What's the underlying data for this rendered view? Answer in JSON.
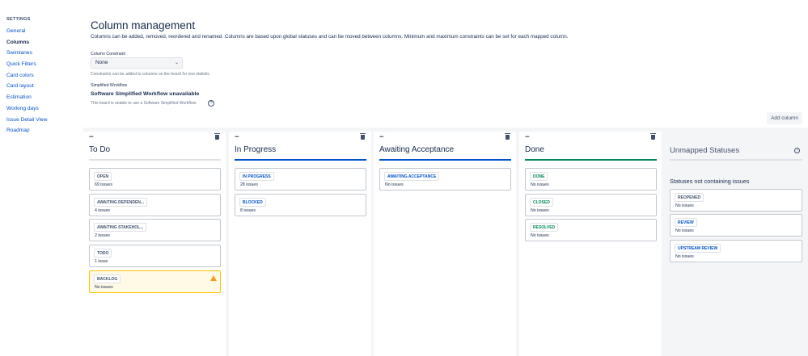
{
  "sidebar": {
    "heading": "SETTINGS",
    "items": [
      {
        "label": "General"
      },
      {
        "label": "Columns"
      },
      {
        "label": "Swimlanes"
      },
      {
        "label": "Quick Filters"
      },
      {
        "label": "Card colors"
      },
      {
        "label": "Card layout"
      },
      {
        "label": "Estimation"
      },
      {
        "label": "Working days"
      },
      {
        "label": "Issue Detail View"
      },
      {
        "label": "Roadmap"
      }
    ],
    "active": "Columns"
  },
  "header": {
    "title": "Column management",
    "description": "Columns can be added, removed, reordered and renamed. Columns are based upon global statuses and can be moved between columns. Minimum and maximum constraints can be set for each mapped column."
  },
  "constraint": {
    "label": "Column Constraint",
    "value": "None",
    "help": "Constraints can be added to columns on the board for one statistic."
  },
  "workflow": {
    "label": "Simplified Workflow",
    "title": "Software Simplified Workflow unavailable",
    "help": "This board is unable to use a Software Simplified Workflow."
  },
  "add_column_label": "Add column",
  "columns": [
    {
      "title": "To Do",
      "bar_color": "#dfe1e6",
      "cards": [
        {
          "status": "OPEN",
          "count": "69 issues",
          "tone": "grey"
        },
        {
          "status": "AWAITING DEPENDEN...",
          "count": "4 issues",
          "tone": "grey"
        },
        {
          "status": "AWAITING STAKEHOL...",
          "count": "2 issues",
          "tone": "grey"
        },
        {
          "status": "TODO",
          "count": "1 issue",
          "tone": "grey"
        },
        {
          "status": "BACKLOG",
          "count": "No issues",
          "tone": "grey",
          "warning": true
        }
      ]
    },
    {
      "title": "In Progress",
      "bar_color": "#0052cc",
      "cards": [
        {
          "status": "IN PROGRESS",
          "count": "28 issues",
          "tone": "blue"
        },
        {
          "status": "BLOCKED",
          "count": "8 issues",
          "tone": "blue"
        }
      ]
    },
    {
      "title": "Awaiting Acceptance",
      "bar_color": "#0052cc",
      "cards": [
        {
          "status": "AWAITING ACCEPTANCE",
          "count": "No issues",
          "tone": "blue"
        }
      ]
    },
    {
      "title": "Done",
      "bar_color": "#00875a",
      "cards": [
        {
          "status": "DONE",
          "count": "No issues",
          "tone": "green"
        },
        {
          "status": "CLOSED",
          "count": "No issues",
          "tone": "green"
        },
        {
          "status": "RESOLVED",
          "count": "No issues",
          "tone": "green"
        }
      ]
    }
  ],
  "unmapped": {
    "title": "Unmapped Statuses",
    "subtitle": "Statuses not containing issues",
    "cards": [
      {
        "status": "REOPENED",
        "count": "No issues",
        "tone": "grey"
      },
      {
        "status": "REVIEW",
        "count": "No issues",
        "tone": "blue"
      },
      {
        "status": "UPSTREAM REVIEW",
        "count": "No issues",
        "tone": "blue"
      }
    ]
  }
}
